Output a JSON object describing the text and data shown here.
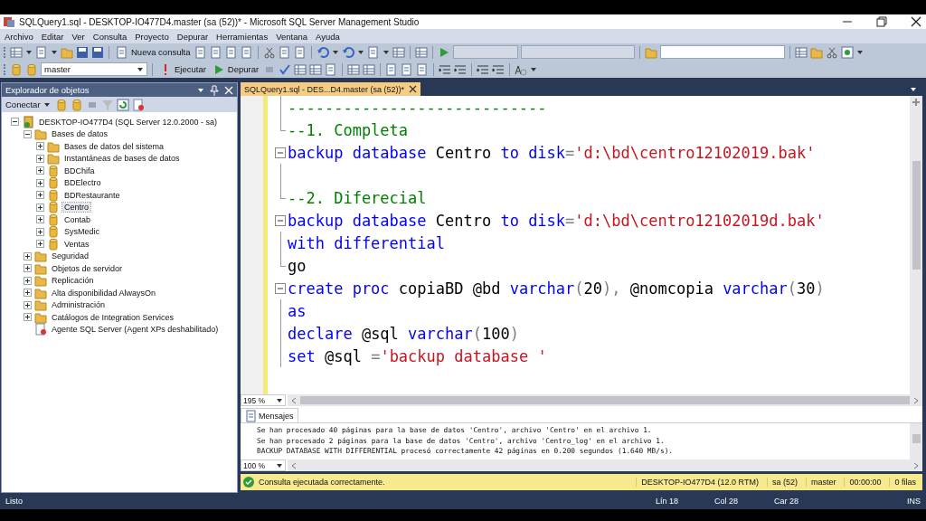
{
  "window": {
    "title": "SQLQuery1.sql - DESKTOP-IO477D4.master (sa (52))* - Microsoft SQL Server Management Studio"
  },
  "menu": [
    "Archivo",
    "Editar",
    "Ver",
    "Consulta",
    "Proyecto",
    "Depurar",
    "Herramientas",
    "Ventana",
    "Ayuda"
  ],
  "toolbar_1": {
    "new_query": "Nueva consulta"
  },
  "toolbar_2": {
    "database": "master",
    "execute": "Ejecutar",
    "debug": "Depurar"
  },
  "object_explorer": {
    "title": "Explorador de objetos",
    "connect": "Conectar",
    "tree": [
      {
        "label": "DESKTOP-IO477D4 (SQL Server 12.0.2000 - sa)",
        "kind": "server",
        "expanded": true,
        "selected": false,
        "children": [
          {
            "label": "Bases de datos",
            "kind": "folder",
            "expanded": true,
            "selected": false,
            "children": [
              {
                "label": "Bases de datos del sistema",
                "kind": "folder",
                "expanded": false,
                "selected": false
              },
              {
                "label": "Instantáneas de bases de datos",
                "kind": "folder",
                "expanded": false,
                "selected": false
              },
              {
                "label": "BDChifa",
                "kind": "database",
                "expanded": false,
                "selected": false
              },
              {
                "label": "BDElectro",
                "kind": "database",
                "expanded": false,
                "selected": false
              },
              {
                "label": "BDRestaurante",
                "kind": "database",
                "expanded": false,
                "selected": false
              },
              {
                "label": "Centro",
                "kind": "database",
                "expanded": false,
                "selected": true
              },
              {
                "label": "Contab",
                "kind": "database",
                "expanded": false,
                "selected": false
              },
              {
                "label": "SysMedic",
                "kind": "database",
                "expanded": false,
                "selected": false
              },
              {
                "label": "Ventas",
                "kind": "database",
                "expanded": false,
                "selected": false
              }
            ]
          },
          {
            "label": "Seguridad",
            "kind": "folder",
            "expanded": false,
            "selected": false
          },
          {
            "label": "Objetos de servidor",
            "kind": "folder",
            "expanded": false,
            "selected": false
          },
          {
            "label": "Replicación",
            "kind": "folder",
            "expanded": false,
            "selected": false
          },
          {
            "label": "Alta disponibilidad AlwaysOn",
            "kind": "folder",
            "expanded": false,
            "selected": false
          },
          {
            "label": "Administración",
            "kind": "folder",
            "expanded": false,
            "selected": false
          },
          {
            "label": "Catálogos de Integration Services",
            "kind": "folder",
            "expanded": false,
            "selected": false
          },
          {
            "label": "Agente SQL Server (Agent XPs deshabilitado)",
            "kind": "agent",
            "selected": false
          }
        ]
      }
    ]
  },
  "editor": {
    "tab": {
      "label": "SQLQuery1.sql - DES...D4.master (sa (52))*",
      "selected": true
    },
    "lines": [
      {
        "kind": "bar",
        "tokens": [
          {
            "kind": "comment",
            "s": "----------------------------"
          }
        ]
      },
      {
        "kind": "end",
        "tokens": [
          {
            "kind": "comment",
            "s": "--1. Completa"
          }
        ]
      },
      {
        "kind": "open",
        "tokens": [
          {
            "kind": "keyword",
            "s": "backup database"
          },
          {
            "kind": "plain",
            "s": " Centro "
          },
          {
            "kind": "keyword",
            "s": "to disk"
          },
          {
            "kind": "operator",
            "s": "="
          },
          {
            "kind": "string",
            "s": "'d:\\bd\\centro12102019.bak'"
          }
        ]
      },
      {
        "kind": "bar"
      },
      {
        "kind": "end",
        "tokens": [
          {
            "kind": "comment",
            "s": "--2. Diferecial"
          }
        ]
      },
      {
        "kind": "open",
        "tokens": [
          {
            "kind": "keyword",
            "s": "backup database"
          },
          {
            "kind": "plain",
            "s": " Centro "
          },
          {
            "kind": "keyword",
            "s": "to disk"
          },
          {
            "kind": "operator",
            "s": "="
          },
          {
            "kind": "string",
            "s": "'d:\\bd\\centro12102019d.bak'"
          }
        ]
      },
      {
        "kind": "bar",
        "tokens": [
          {
            "kind": "keyword",
            "s": "with differential"
          }
        ]
      },
      {
        "kind": "end",
        "tokens": [
          {
            "kind": "plain",
            "s": "go"
          }
        ]
      },
      {
        "kind": "open",
        "tokens": [
          {
            "kind": "keyword",
            "s": "create proc"
          },
          {
            "kind": "plain",
            "s": " copiaBD @bd "
          },
          {
            "kind": "keyword",
            "s": "varchar"
          },
          {
            "kind": "operator",
            "s": "("
          },
          {
            "kind": "plain",
            "s": "20"
          },
          {
            "kind": "operator",
            "s": "),"
          },
          {
            "kind": "plain",
            "s": " @nomcopia "
          },
          {
            "kind": "keyword",
            "s": "varchar"
          },
          {
            "kind": "operator",
            "s": "("
          },
          {
            "kind": "plain",
            "s": "30"
          },
          {
            "kind": "operator",
            "s": ")"
          }
        ]
      },
      {
        "kind": "bar",
        "tokens": [
          {
            "kind": "keyword",
            "s": "as"
          }
        ]
      },
      {
        "kind": "bar",
        "tokens": [
          {
            "kind": "keyword",
            "s": "declare"
          },
          {
            "kind": "plain",
            "s": " @sql "
          },
          {
            "kind": "keyword",
            "s": "varchar"
          },
          {
            "kind": "operator",
            "s": "("
          },
          {
            "kind": "plain",
            "s": "100"
          },
          {
            "kind": "operator",
            "s": ")"
          }
        ]
      },
      {
        "kind": "bar",
        "tokens": [
          {
            "kind": "keyword",
            "s": "set"
          },
          {
            "kind": "plain",
            "s": " @sql "
          },
          {
            "kind": "operator",
            "s": "="
          },
          {
            "kind": "string",
            "s": "'backup database '"
          }
        ]
      }
    ],
    "zoom": "195 %"
  },
  "results": {
    "tab": {
      "label": "Mensajes",
      "selected": true
    },
    "messages": [
      "Se han procesado 40 páginas para la base de datos 'Centro', archivo 'Centro' en el archivo 1.",
      "Se han procesado 2 páginas para la base de datos 'Centro', archivo 'Centro_log' en el archivo 1.",
      "BACKUP DATABASE WITH DIFFERENTIAL procesó correctamente 42 páginas en 0.200 segundos (1.640 MB/s)."
    ],
    "zoom": "100 %"
  },
  "query_status": {
    "message": "Consulta ejecutada correctamente.",
    "cells": [
      "DESKTOP-IO477D4 (12.0 RTM)",
      "sa (52)",
      "master",
      "00:00:00",
      "0 filas"
    ]
  },
  "status_bar": {
    "left": "Listo",
    "cells": [
      "Lín 18",
      "Col 28",
      "Car 28",
      "INS"
    ]
  }
}
